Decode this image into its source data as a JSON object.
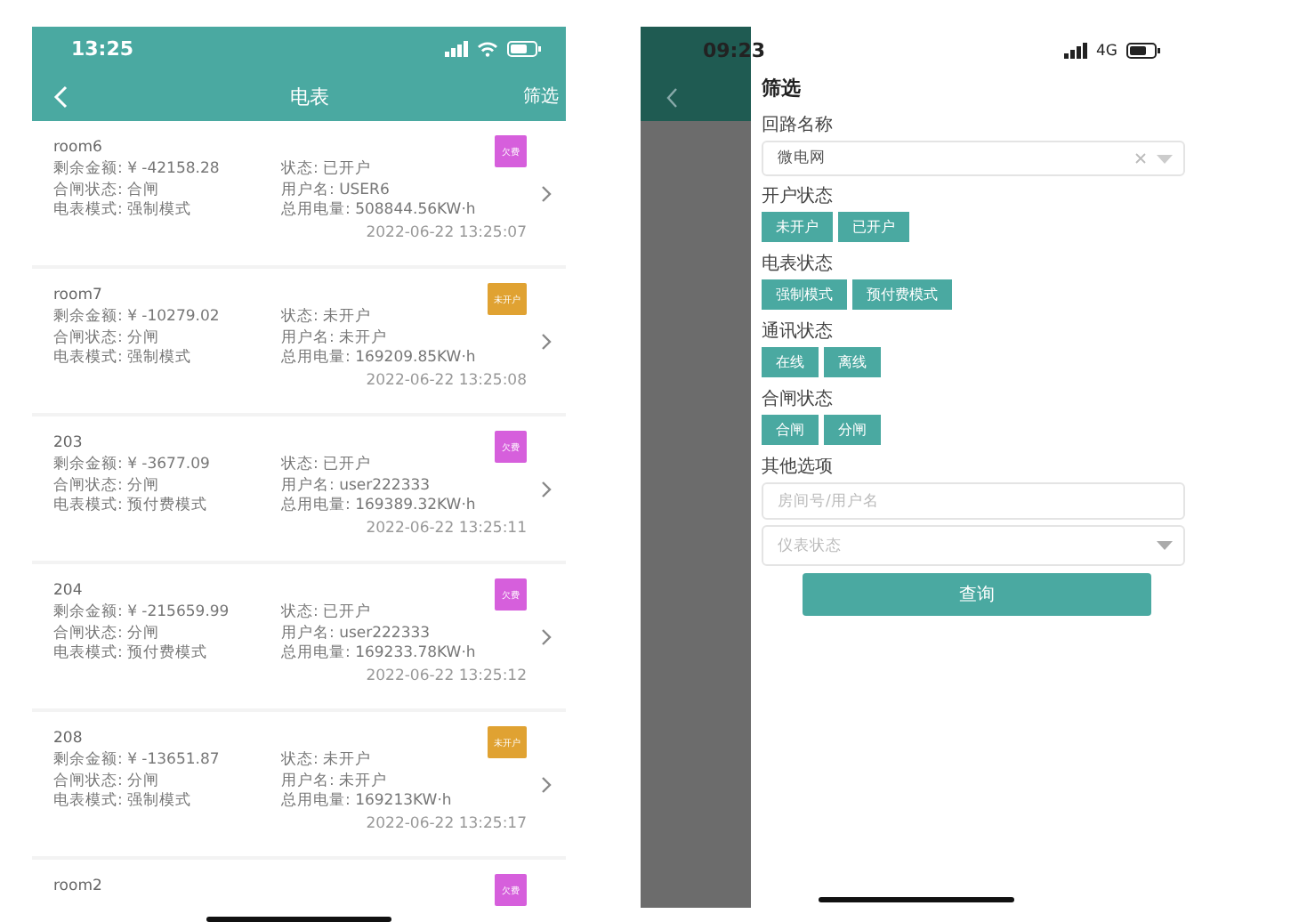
{
  "list_screen": {
    "status_bar": {
      "time": "13:25"
    },
    "nav": {
      "title": "电表",
      "action": "筛选"
    },
    "meters": [
      {
        "name": "room6",
        "badge": {
          "label": "欠费",
          "color": "#d65fdc"
        },
        "balance": "剩余金额: ¥ -42158.28",
        "status": "状态: 已开户",
        "switch_state": "合闸状态: 合闸",
        "user": "用户名: USER6",
        "mode": "电表模式: 强制模式",
        "usage": "总用电量: 508844.56KW·h",
        "time": "2022-06-22 13:25:07"
      },
      {
        "name": "room7",
        "badge": {
          "label": "未开户",
          "color": "#e0a232"
        },
        "balance": "剩余金额: ¥ -10279.02",
        "status": "状态: 未开户",
        "switch_state": "合闸状态: 分闸",
        "user": "用户名: 未开户",
        "mode": "电表模式: 强制模式",
        "usage": "总用电量: 169209.85KW·h",
        "time": "2022-06-22 13:25:08"
      },
      {
        "name": "203",
        "badge": {
          "label": "欠费",
          "color": "#d65fdc"
        },
        "balance": "剩余金额: ¥ -3677.09",
        "status": "状态: 已开户",
        "switch_state": "合闸状态: 分闸",
        "user": "用户名: user222333",
        "mode": "电表模式: 预付费模式",
        "usage": "总用电量: 169389.32KW·h",
        "time": "2022-06-22 13:25:11"
      },
      {
        "name": "204",
        "badge": {
          "label": "欠费",
          "color": "#d65fdc"
        },
        "balance": "剩余金额: ¥ -215659.99",
        "status": "状态: 已开户",
        "switch_state": "合闸状态: 分闸",
        "user": "用户名: user222333",
        "mode": "电表模式: 预付费模式",
        "usage": "总用电量: 169233.78KW·h",
        "time": "2022-06-22 13:25:12"
      },
      {
        "name": "208",
        "badge": {
          "label": "未开户",
          "color": "#e0a232"
        },
        "balance": "剩余金额: ¥ -13651.87",
        "status": "状态: 未开户",
        "switch_state": "合闸状态: 分闸",
        "user": "用户名: 未开户",
        "mode": "电表模式: 强制模式",
        "usage": "总用电量: 169213KW·h",
        "time": "2022-06-22 13:25:17"
      },
      {
        "name": "room2",
        "badge": {
          "label": "欠费",
          "color": "#d65fdc"
        }
      }
    ]
  },
  "filter_screen": {
    "status_bar": {
      "time": "09:23",
      "network": "4G"
    },
    "title": "筛选",
    "sections": [
      {
        "kind": "select",
        "label": "回路名称",
        "value": "微电网"
      },
      {
        "kind": "chips",
        "label": "开户状态",
        "options": [
          "未开户",
          "已开户"
        ]
      },
      {
        "kind": "chips",
        "label": "电表状态",
        "options": [
          "强制模式",
          "预付费模式"
        ]
      },
      {
        "kind": "chips",
        "label": "通讯状态",
        "options": [
          "在线",
          "离线"
        ]
      },
      {
        "kind": "chips",
        "label": "合闸状态",
        "options": [
          "合闸",
          "分闸"
        ]
      },
      {
        "kind": "other",
        "label": "其他选项",
        "input_placeholder": "房间号/用户名",
        "select_placeholder": "仪表状态"
      }
    ],
    "submit": "查询"
  }
}
